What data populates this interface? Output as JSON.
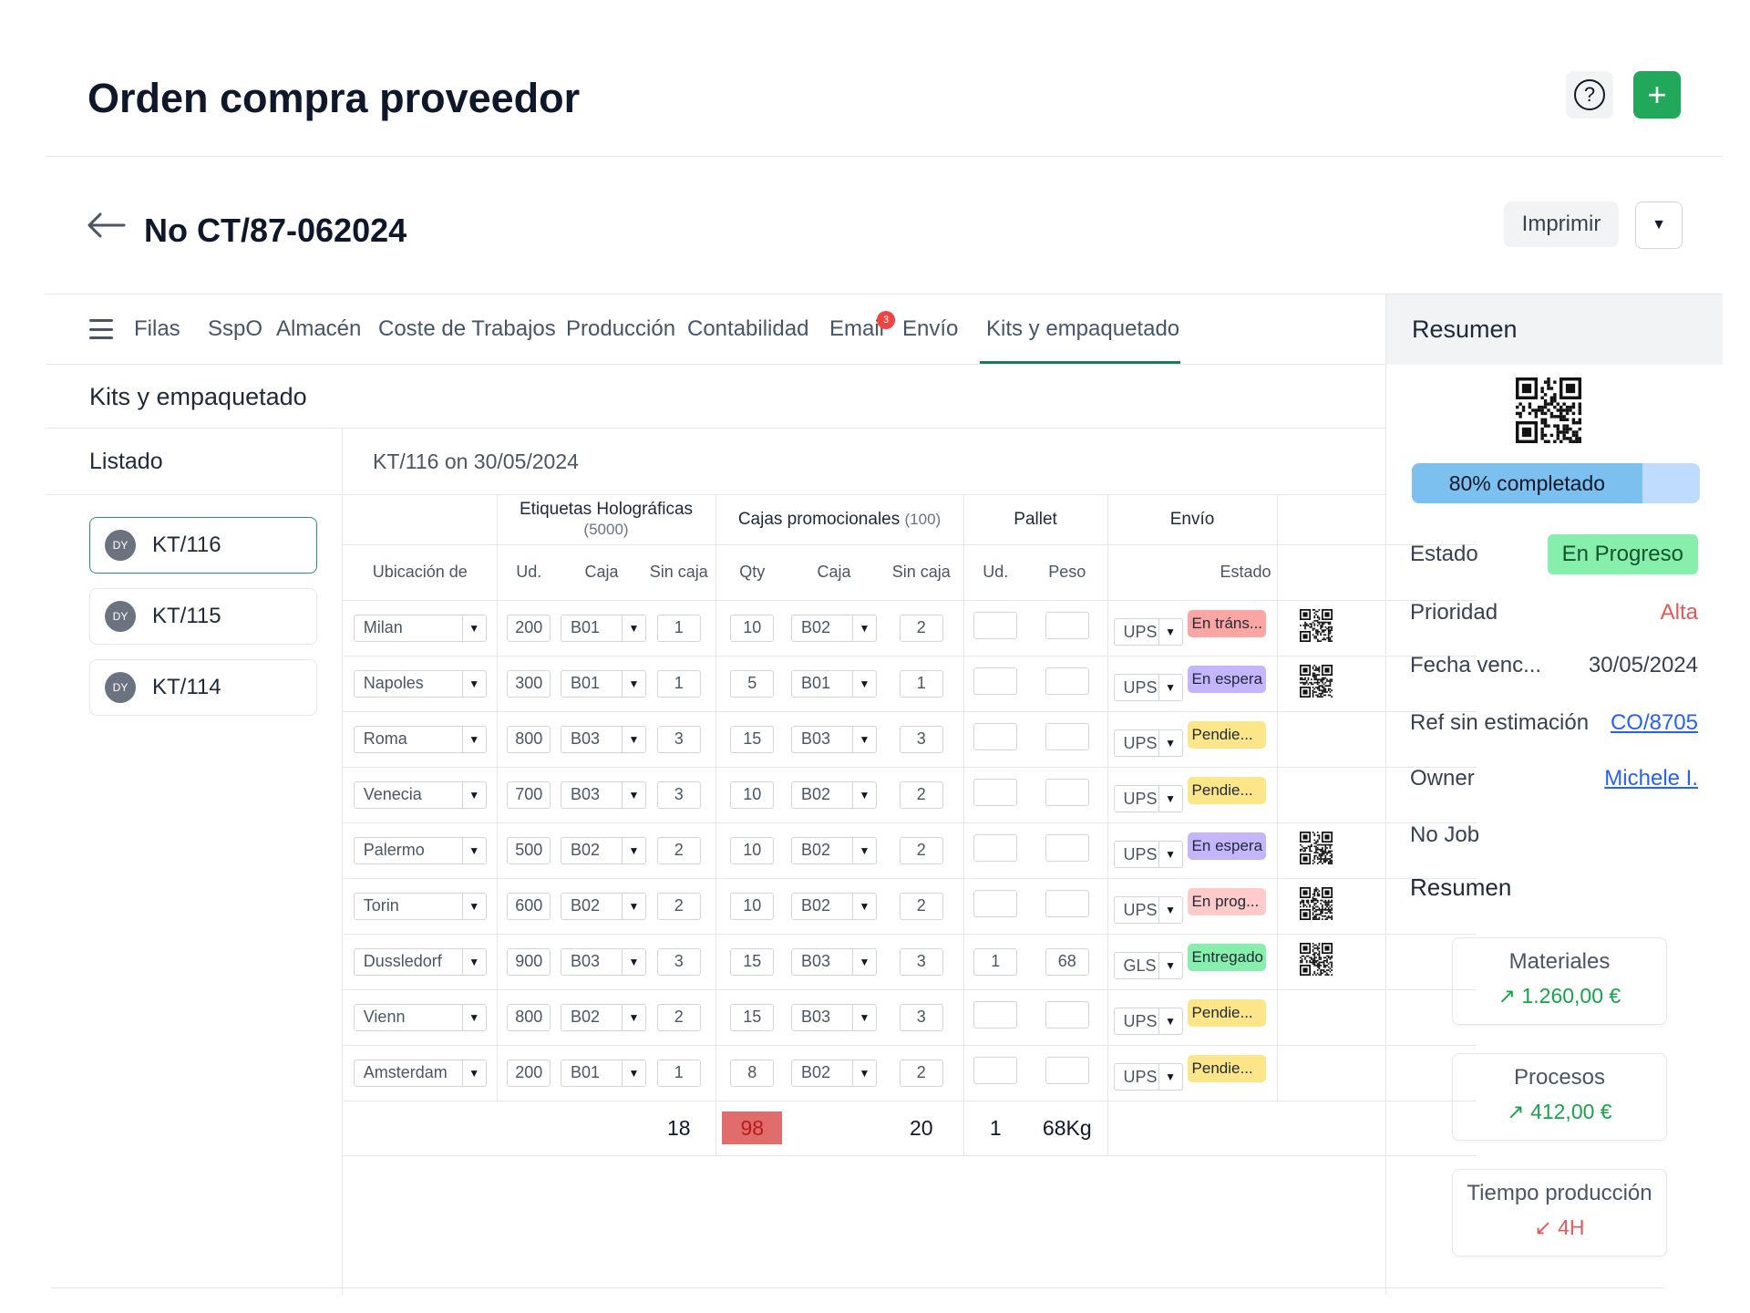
{
  "page": {
    "title": "Orden compra proveedor"
  },
  "header_actions": {
    "help_icon": "question-circle-icon",
    "add_label": "+"
  },
  "document": {
    "number": "No CT/87-062024",
    "print_label": "Imprimir",
    "dropdown_icon": "chevron-down-icon"
  },
  "tabs": [
    {
      "label": "Filas"
    },
    {
      "label": "SspO"
    },
    {
      "label": "Almacén"
    },
    {
      "label": "Coste de Trabajos"
    },
    {
      "label": "Producción"
    },
    {
      "label": "Contabilidad"
    },
    {
      "label": "Email",
      "badge": "3"
    },
    {
      "label": "Envío"
    },
    {
      "label": "Kits y empaquetado",
      "active": true
    }
  ],
  "section": {
    "title": "Kits y empaquetado"
  },
  "list": {
    "header": "Listado",
    "items": [
      {
        "avatar": "DY",
        "label": "KT/116",
        "active": true
      },
      {
        "avatar": "DY",
        "label": "KT/115"
      },
      {
        "avatar": "DY",
        "label": "KT/114"
      }
    ]
  },
  "kit": {
    "header": "KT/116 on 30/05/2024",
    "groups": {
      "labels": {
        "name": "Etiquetas Holográficas",
        "count": "(5000)"
      },
      "boxes": {
        "name": "Cajas promocionales",
        "count": "(100)"
      },
      "pallet": "Pallet",
      "shipping": "Envío"
    },
    "columns": {
      "location": "Ubicación de",
      "ud": "Ud.",
      "box": "Caja",
      "nobox": "Sin caja",
      "qty": "Qty",
      "box2": "Caja",
      "nobox2": "Sin caja",
      "pallet_ud": "Ud.",
      "weight": "Peso",
      "status": "Estado"
    },
    "rows": [
      {
        "loc": "Milan",
        "ud": "200",
        "box": "B01",
        "nobox": "1",
        "qty": "10",
        "box2": "B02",
        "nobox2": "2",
        "pud": "",
        "peso": "",
        "carrier": "UPS",
        "status": "En tráns...",
        "st": "transit",
        "qr": true
      },
      {
        "loc": "Napoles",
        "ud": "300",
        "box": "B01",
        "nobox": "1",
        "qty": "5",
        "box2": "B01",
        "nobox2": "1",
        "pud": "",
        "peso": "",
        "carrier": "UPS",
        "status": "En espera",
        "st": "wait",
        "qr": true
      },
      {
        "loc": "Roma",
        "ud": "800",
        "box": "B03",
        "nobox": "3",
        "qty": "15",
        "box2": "B03",
        "nobox2": "3",
        "pud": "",
        "peso": "",
        "carrier": "UPS",
        "status": "Pendie...",
        "st": "pend",
        "qr": false
      },
      {
        "loc": "Venecia",
        "ud": "700",
        "box": "B03",
        "nobox": "3",
        "qty": "10",
        "box2": "B02",
        "nobox2": "2",
        "pud": "",
        "peso": "",
        "carrier": "UPS",
        "status": "Pendie...",
        "st": "pend",
        "qr": false
      },
      {
        "loc": "Palermo",
        "ud": "500",
        "box": "B02",
        "nobox": "2",
        "qty": "10",
        "box2": "B02",
        "nobox2": "2",
        "pud": "",
        "peso": "",
        "carrier": "UPS",
        "status": "En espera",
        "st": "wait",
        "qr": true
      },
      {
        "loc": "Torin",
        "ud": "600",
        "box": "B02",
        "nobox": "2",
        "qty": "10",
        "box2": "B02",
        "nobox2": "2",
        "pud": "",
        "peso": "",
        "carrier": "UPS",
        "status": "En prog...",
        "st": "prog",
        "qr": true
      },
      {
        "loc": "Dussledorf",
        "ud": "900",
        "box": "B03",
        "nobox": "3",
        "qty": "15",
        "box2": "B03",
        "nobox2": "3",
        "pud": "1",
        "peso": "68",
        "carrier": "GLS",
        "status": "Entregado",
        "st": "done",
        "qr": true
      },
      {
        "loc": "Vienn",
        "ud": "800",
        "box": "B02",
        "nobox": "2",
        "qty": "15",
        "box2": "B03",
        "nobox2": "3",
        "pud": "",
        "peso": "",
        "carrier": "UPS",
        "status": "Pendie...",
        "st": "pend",
        "qr": false
      },
      {
        "loc": "Amsterdam",
        "ud": "200",
        "box": "B01",
        "nobox": "1",
        "qty": "8",
        "box2": "B02",
        "nobox2": "2",
        "pud": "",
        "peso": "",
        "carrier": "UPS",
        "status": "Pendie...",
        "st": "pend",
        "qr": false
      }
    ],
    "totals": {
      "nobox": "18",
      "qty": "98",
      "nobox2": "20",
      "pallet_ud": "1",
      "weight": "68Kg"
    }
  },
  "summary": {
    "title": "Resumen",
    "progress_label": "80% completado",
    "progress": 0.8,
    "fields": {
      "estado_label": "Estado",
      "estado_value": "En Progreso",
      "prioridad_label": "Prioridad",
      "prioridad_value": "Alta",
      "fecha_label": "Fecha venc...",
      "fecha_value": "30/05/2024",
      "ref_label": "Ref sin estimación",
      "ref_value": "CO/8705",
      "owner_label": "Owner",
      "owner_value": "Michele I.",
      "job_label": "No Job"
    },
    "subtitle": "Resumen",
    "kpis": [
      {
        "title": "Materiales",
        "value": "1.260,00 €",
        "trend": "up"
      },
      {
        "title": "Procesos",
        "value": "412,00 €",
        "trend": "up"
      },
      {
        "title": "Tiempo producción",
        "value": "4H",
        "trend": "down"
      }
    ]
  },
  "colors": {
    "primary": "#22a85a",
    "accent_tab": "#1f7a5c",
    "danger": "#e05a5a",
    "link": "#2563eb"
  }
}
